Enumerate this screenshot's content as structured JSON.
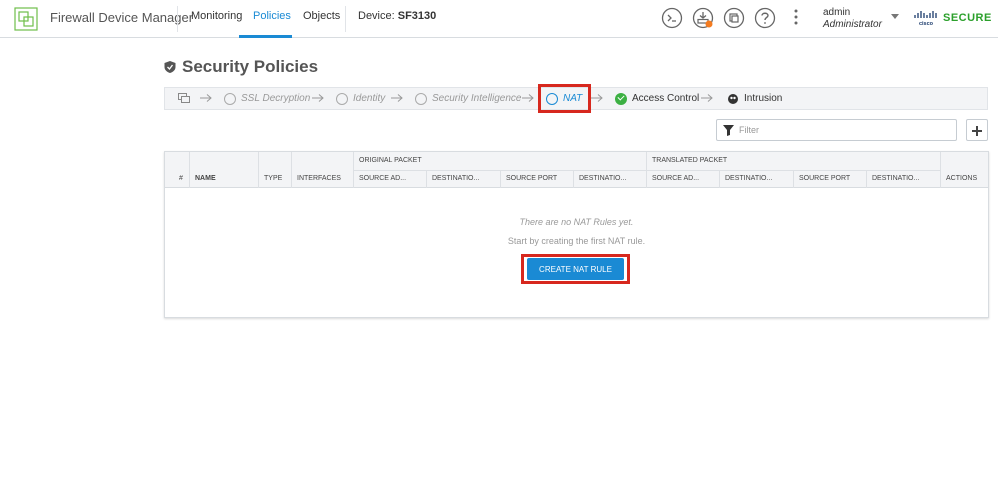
{
  "header": {
    "app_title": "Firewall Device Manager",
    "nav": [
      {
        "label": "Monitoring",
        "active": false
      },
      {
        "label": "Policies",
        "active": true
      },
      {
        "label": "Objects",
        "active": false
      }
    ],
    "device_label": "Device:",
    "device_name": "SF3130",
    "user": {
      "name": "admin",
      "role": "Administrator"
    },
    "brand": "SECURE",
    "icons": [
      "cli-console-icon",
      "deployment-icon",
      "tasks-icon",
      "help-icon",
      "more-menu-icon"
    ],
    "accent_color": "#1a8ad4",
    "notification_color": "#f47c20"
  },
  "page": {
    "title": "Security Policies"
  },
  "policy_chain": {
    "items": [
      {
        "label": "SSL Decryption",
        "status": "inactive"
      },
      {
        "label": "Identity",
        "status": "inactive"
      },
      {
        "label": "Security Intelligence",
        "status": "inactive"
      },
      {
        "label": "NAT",
        "status": "selected"
      },
      {
        "label": "Access Control",
        "status": "enabled"
      },
      {
        "label": "Intrusion",
        "status": "enabled"
      }
    ]
  },
  "filter": {
    "placeholder": "Filter"
  },
  "table": {
    "group_headers": {
      "original": "ORIGINAL PACKET",
      "translated": "TRANSLATED PACKET"
    },
    "columns": [
      "#",
      "NAME",
      "TYPE",
      "INTERFACES",
      "SOURCE AD...",
      "DESTINATIO...",
      "SOURCE PORT",
      "DESTINATIO...",
      "SOURCE AD...",
      "DESTINATIO...",
      "SOURCE PORT",
      "DESTINATIO...",
      "ACTIONS"
    ],
    "empty_title": "There are no NAT Rules yet.",
    "empty_subtitle": "Start by creating the first NAT rule.",
    "create_button": "CREATE NAT RULE"
  },
  "highlight_color": "#d7281e"
}
